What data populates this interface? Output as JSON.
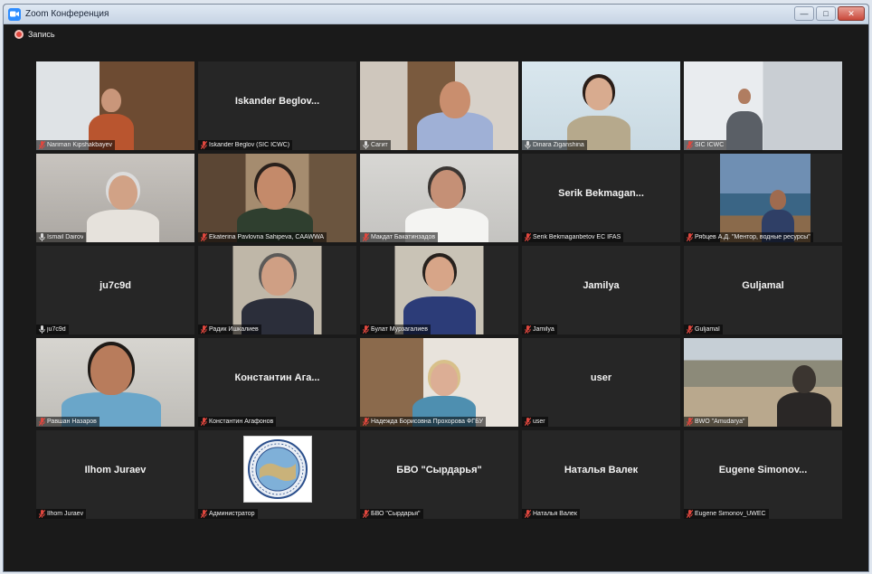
{
  "window": {
    "title": "Zoom Конференция",
    "controls": [
      "—",
      "□",
      "✕"
    ]
  },
  "recording": {
    "label": "Запись"
  },
  "tiles": [
    {
      "name": "Nariman Kipshakbayev",
      "center": "",
      "mic_muted": true
    },
    {
      "name": "Iskander Beglov (SIC ICWC)",
      "center": "Iskander Beglov...",
      "mic_muted": true
    },
    {
      "name": "Сагит",
      "center": "",
      "mic_muted": false
    },
    {
      "name": "Dinara Ziganshina",
      "center": "",
      "mic_muted": false,
      "active": true
    },
    {
      "name": "SIC ICWC",
      "center": "",
      "mic_muted": true
    },
    {
      "name": "Ismail Dairov",
      "center": "",
      "mic_muted": false
    },
    {
      "name": "Ekaterina Pavlovna Sahipeva, CAAWWA",
      "center": "",
      "mic_muted": true
    },
    {
      "name": "Макдат Бакатинзадов",
      "center": "",
      "mic_muted": true
    },
    {
      "name": "Serik Bekmaganbetov EC IFAS",
      "center": "Serik Bekmagan...",
      "mic_muted": true
    },
    {
      "name": "Рябцев А.Д. \"Ментор, водные ресурсы\"",
      "center": "",
      "mic_muted": true
    },
    {
      "name": "ju7c9d",
      "center": "ju7c9d",
      "mic_muted": false
    },
    {
      "name": "Радик Ишкалиев",
      "center": "",
      "mic_muted": true
    },
    {
      "name": "Булат Мурзагалиев",
      "center": "",
      "mic_muted": true
    },
    {
      "name": "Jamilya",
      "center": "Jamilya",
      "mic_muted": true
    },
    {
      "name": "Guljamal",
      "center": "Guljamal",
      "mic_muted": true
    },
    {
      "name": "Равшан Назаров",
      "center": "",
      "mic_muted": true
    },
    {
      "name": "Константин Агафонов",
      "center": "Константин Ага...",
      "mic_muted": true
    },
    {
      "name": "Надежда Борисовна Прохорова ФГБУ",
      "center": "",
      "mic_muted": true
    },
    {
      "name": "user",
      "center": "user",
      "mic_muted": true
    },
    {
      "name": "BWO \"Amudarya\"",
      "center": "",
      "mic_muted": true
    },
    {
      "name": "Ilhom Juraev",
      "center": "Ilhom Juraev",
      "mic_muted": true
    },
    {
      "name": "Администратор",
      "center": "",
      "mic_muted": true
    },
    {
      "name": "БВО \"Сырдарья\"",
      "center": "БВО \"Сырдарья\"",
      "mic_muted": true
    },
    {
      "name": "Наталья Валек",
      "center": "Наталья Валек",
      "mic_muted": true
    },
    {
      "name": "Eugene Simonov_UWEC",
      "center": "Eugene Simonov...",
      "mic_muted": true
    }
  ],
  "colors": {
    "active_speaker": "#c8e23a",
    "muted_mic": "#e0473e",
    "tile_bg": "#262626"
  }
}
